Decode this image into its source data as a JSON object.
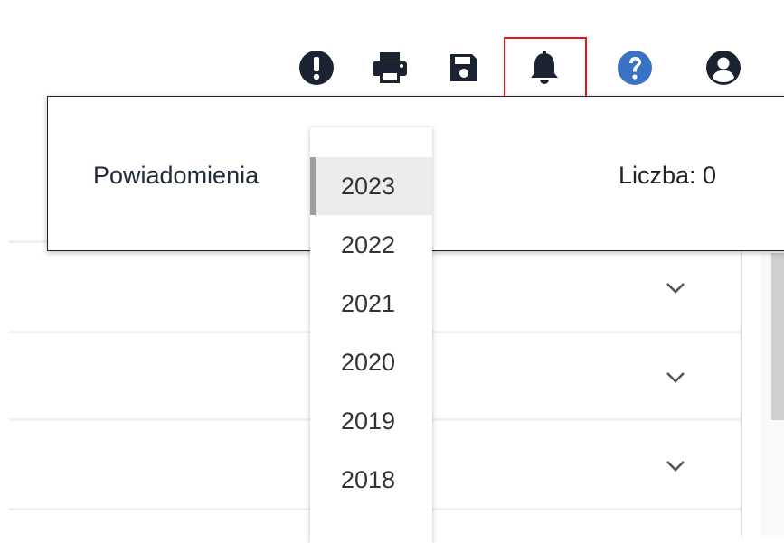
{
  "toolbar": {
    "icons": [
      "exclamation-icon",
      "printer-icon",
      "save-icon",
      "bell-icon",
      "help-icon",
      "account-icon"
    ],
    "colors": {
      "dark": "#1b2333",
      "help": "#3b73c4",
      "highlight": "#e8141b"
    }
  },
  "notifications": {
    "title": "Powiadomienia",
    "count_label": "Liczba: 0"
  },
  "year_dropdown": {
    "selected": "2023",
    "options": [
      "2023",
      "2022",
      "2021",
      "2020",
      "2019",
      "2018"
    ]
  }
}
